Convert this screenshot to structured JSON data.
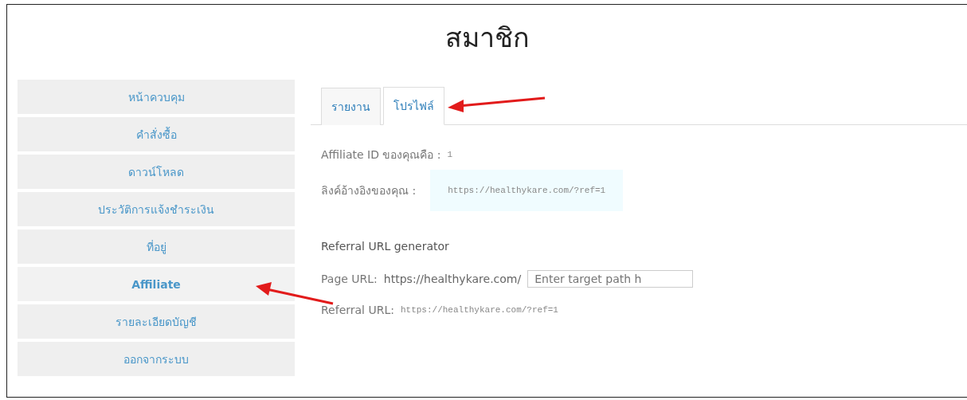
{
  "title": "สมาชิก",
  "sidebar": {
    "items": [
      {
        "label": "หน้าควบคุม",
        "selected": false
      },
      {
        "label": "คำสั่งซื้อ",
        "selected": false
      },
      {
        "label": "ดาวน์โหลด",
        "selected": false
      },
      {
        "label": "ประวัติการแจ้งชำระเงิน",
        "selected": false
      },
      {
        "label": "ที่อยู่",
        "selected": false
      },
      {
        "label": "Affiliate",
        "selected": true
      },
      {
        "label": "รายละเอียดบัญชี",
        "selected": false
      },
      {
        "label": "ออกจากระบบ",
        "selected": false
      }
    ]
  },
  "tabs": [
    {
      "label": "รายงาน",
      "selected": false
    },
    {
      "label": "โปรไฟล์",
      "selected": true
    }
  ],
  "affiliate_id": {
    "label": "Affiliate ID ของคุณคือ :",
    "value": "1"
  },
  "referral_link": {
    "label": "ลิงค์อ้างอิงของคุณ :",
    "value": "https://healthykare.com/?ref=1"
  },
  "generator": {
    "heading": "Referral URL generator",
    "page_url_label": "Page URL:",
    "base_url": "https://healthykare.com/",
    "placeholder": "Enter target path h",
    "result_label": "Referral URL:",
    "result_value": "https://healthykare.com/?ref=1"
  }
}
